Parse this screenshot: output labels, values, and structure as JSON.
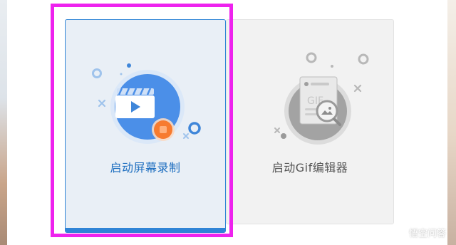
{
  "cards": {
    "record": {
      "label": "启动屏幕录制",
      "selected": true
    },
    "gif": {
      "label": "启动Gif编辑器",
      "doc_text": "GIF"
    }
  },
  "watermark": {
    "text": "悟空问答",
    "logo": "wukong-logo-icon"
  },
  "colors": {
    "accent": "#2f84d6",
    "highlight": "#ee22ee",
    "record_orange": "#f77b2f",
    "gif_gray": "#a9a9a9"
  }
}
